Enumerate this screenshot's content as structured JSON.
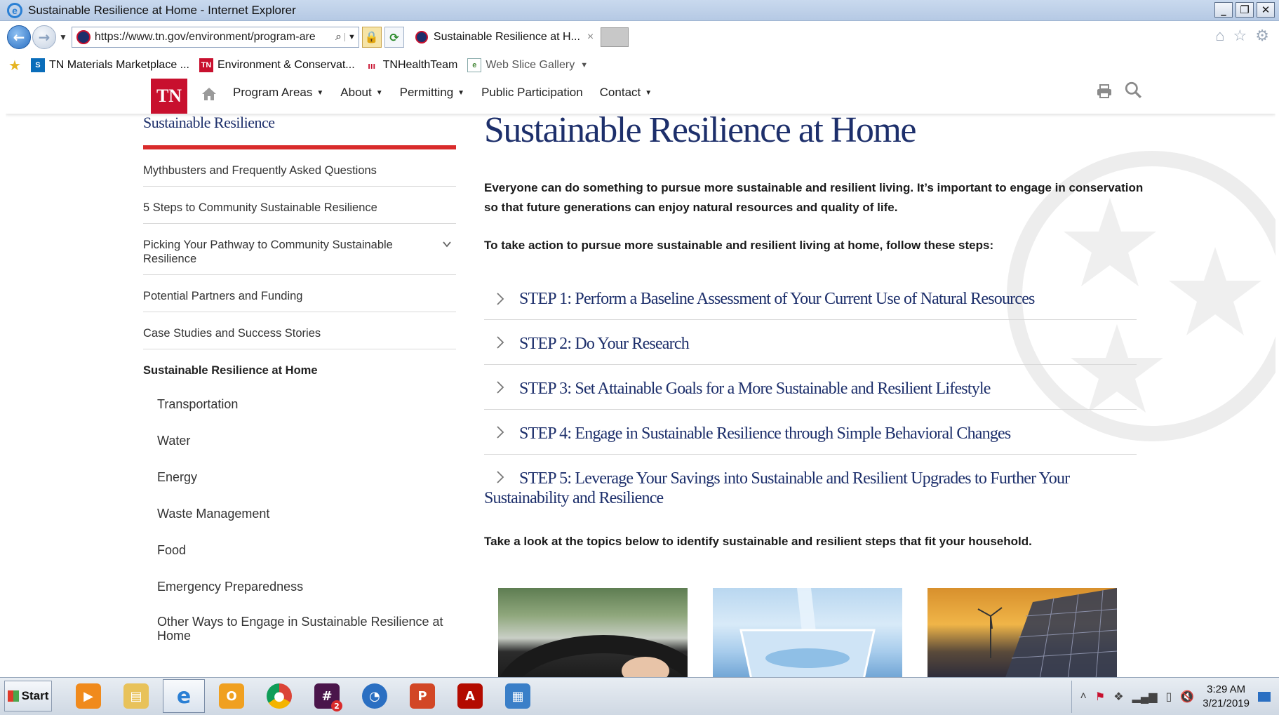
{
  "browser": {
    "window_title": "Sustainable Resilience at Home - Internet Explorer",
    "url": "https://www.tn.gov/environment/program-are",
    "tab_title": "Sustainable Resilience at H...",
    "tab_close": "×",
    "favorites": [
      {
        "label": "TN Materials Marketplace ...",
        "icon": "sharepoint-icon"
      },
      {
        "label": "Environment & Conservat...",
        "icon": "tn-icon"
      },
      {
        "label": "TNHealthTeam",
        "icon": "health-team-icon"
      },
      {
        "label": "Web Slice Gallery",
        "icon": "web-slice-icon"
      }
    ]
  },
  "site": {
    "logo_text": "TN",
    "nav": [
      {
        "label": "Program Areas",
        "dropdown": true
      },
      {
        "label": "About",
        "dropdown": true
      },
      {
        "label": "Permitting",
        "dropdown": true
      },
      {
        "label": "Public Participation",
        "dropdown": false
      },
      {
        "label": "Contact",
        "dropdown": true
      }
    ]
  },
  "sidebar": {
    "title": "Sustainable Resilience",
    "items": [
      {
        "label": "Mythbusters and Frequently Asked Questions"
      },
      {
        "label": "5 Steps to Community Sustainable Resilience"
      },
      {
        "label": "Picking Your Pathway to Community Sustainable Resilience",
        "expandable": true
      },
      {
        "label": "Potential Partners and Funding"
      },
      {
        "label": "Case Studies and Success Stories"
      },
      {
        "label": "Sustainable Resilience at Home",
        "active": true
      }
    ],
    "subitems": [
      {
        "label": "Transportation"
      },
      {
        "label": "Water"
      },
      {
        "label": "Energy"
      },
      {
        "label": "Waste Management"
      },
      {
        "label": "Food"
      },
      {
        "label": "Emergency Preparedness"
      },
      {
        "label": "Other Ways to Engage in Sustainable Resilience at Home"
      }
    ]
  },
  "main": {
    "title": "Sustainable Resilience at Home",
    "intro": "Everyone can do something to pursue more sustainable and resilient living. It’s important to engage in conservation so that future generations can enjoy natural resources and quality of life.",
    "instructions": "To take action to pursue more sustainable and resilient living at home, follow these steps:",
    "steps": [
      {
        "label": "STEP 1: Perform a Baseline Assessment of Your Current Use of Natural Resources"
      },
      {
        "label": "STEP 2: Do Your Research"
      },
      {
        "label": "STEP 3: Set Attainable Goals for a More Sustainable and Resilient Lifestyle"
      },
      {
        "label": "STEP 4: Engage in Sustainable Resilience through Simple Behavioral Changes"
      },
      {
        "label": "STEP 5: Leverage Your Savings into Sustainable and Resilient Upgrades to Further Your Sustainability and Resilience"
      }
    ],
    "outro": "Take a look at the topics below to identify sustainable and resilient steps that fit your household."
  },
  "taskbar": {
    "start_label": "Start",
    "slack_badge": "2",
    "time": "3:29 AM",
    "date": "3/21/2019"
  },
  "colors": {
    "brand_navy": "#1d2f6b",
    "brand_red": "#c8102e",
    "sidebar_rule": "#d92b2b"
  }
}
